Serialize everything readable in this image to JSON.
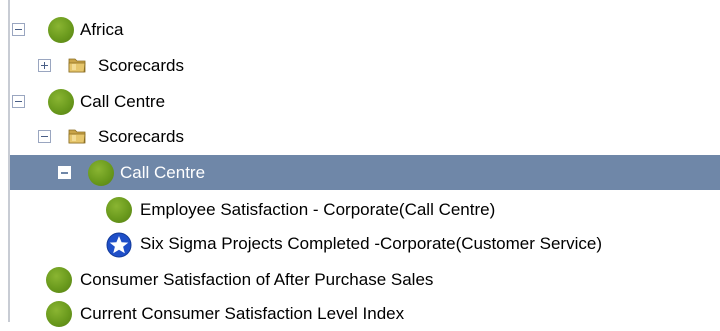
{
  "tree": {
    "rows": [
      {
        "label": "Africa",
        "icon": "green-circle",
        "toggle": "minus"
      },
      {
        "label": "Scorecards",
        "icon": "folder",
        "toggle": "plus"
      },
      {
        "label": "Call Centre",
        "icon": "green-circle",
        "toggle": "minus"
      },
      {
        "label": "Scorecards",
        "icon": "folder",
        "toggle": "minus"
      },
      {
        "label": "Call Centre",
        "icon": "green-circle",
        "toggle": "minus",
        "selected": true
      },
      {
        "label": "Employee Satisfaction - Corporate(Call Centre)",
        "icon": "green-circle"
      },
      {
        "label": "Six Sigma Projects Completed -Corporate(Customer Service)",
        "icon": "star-badge"
      },
      {
        "label": "Consumer Satisfaction of After Purchase Sales",
        "icon": "green-circle"
      },
      {
        "label": "Current Consumer Satisfaction Level Index",
        "icon": "green-circle"
      }
    ]
  },
  "colors": {
    "selected_row": "#6f87a8",
    "status_green": "#6a9a1d",
    "star_blue": "#1f4fc8",
    "folder_tan": "#d4b25a"
  }
}
